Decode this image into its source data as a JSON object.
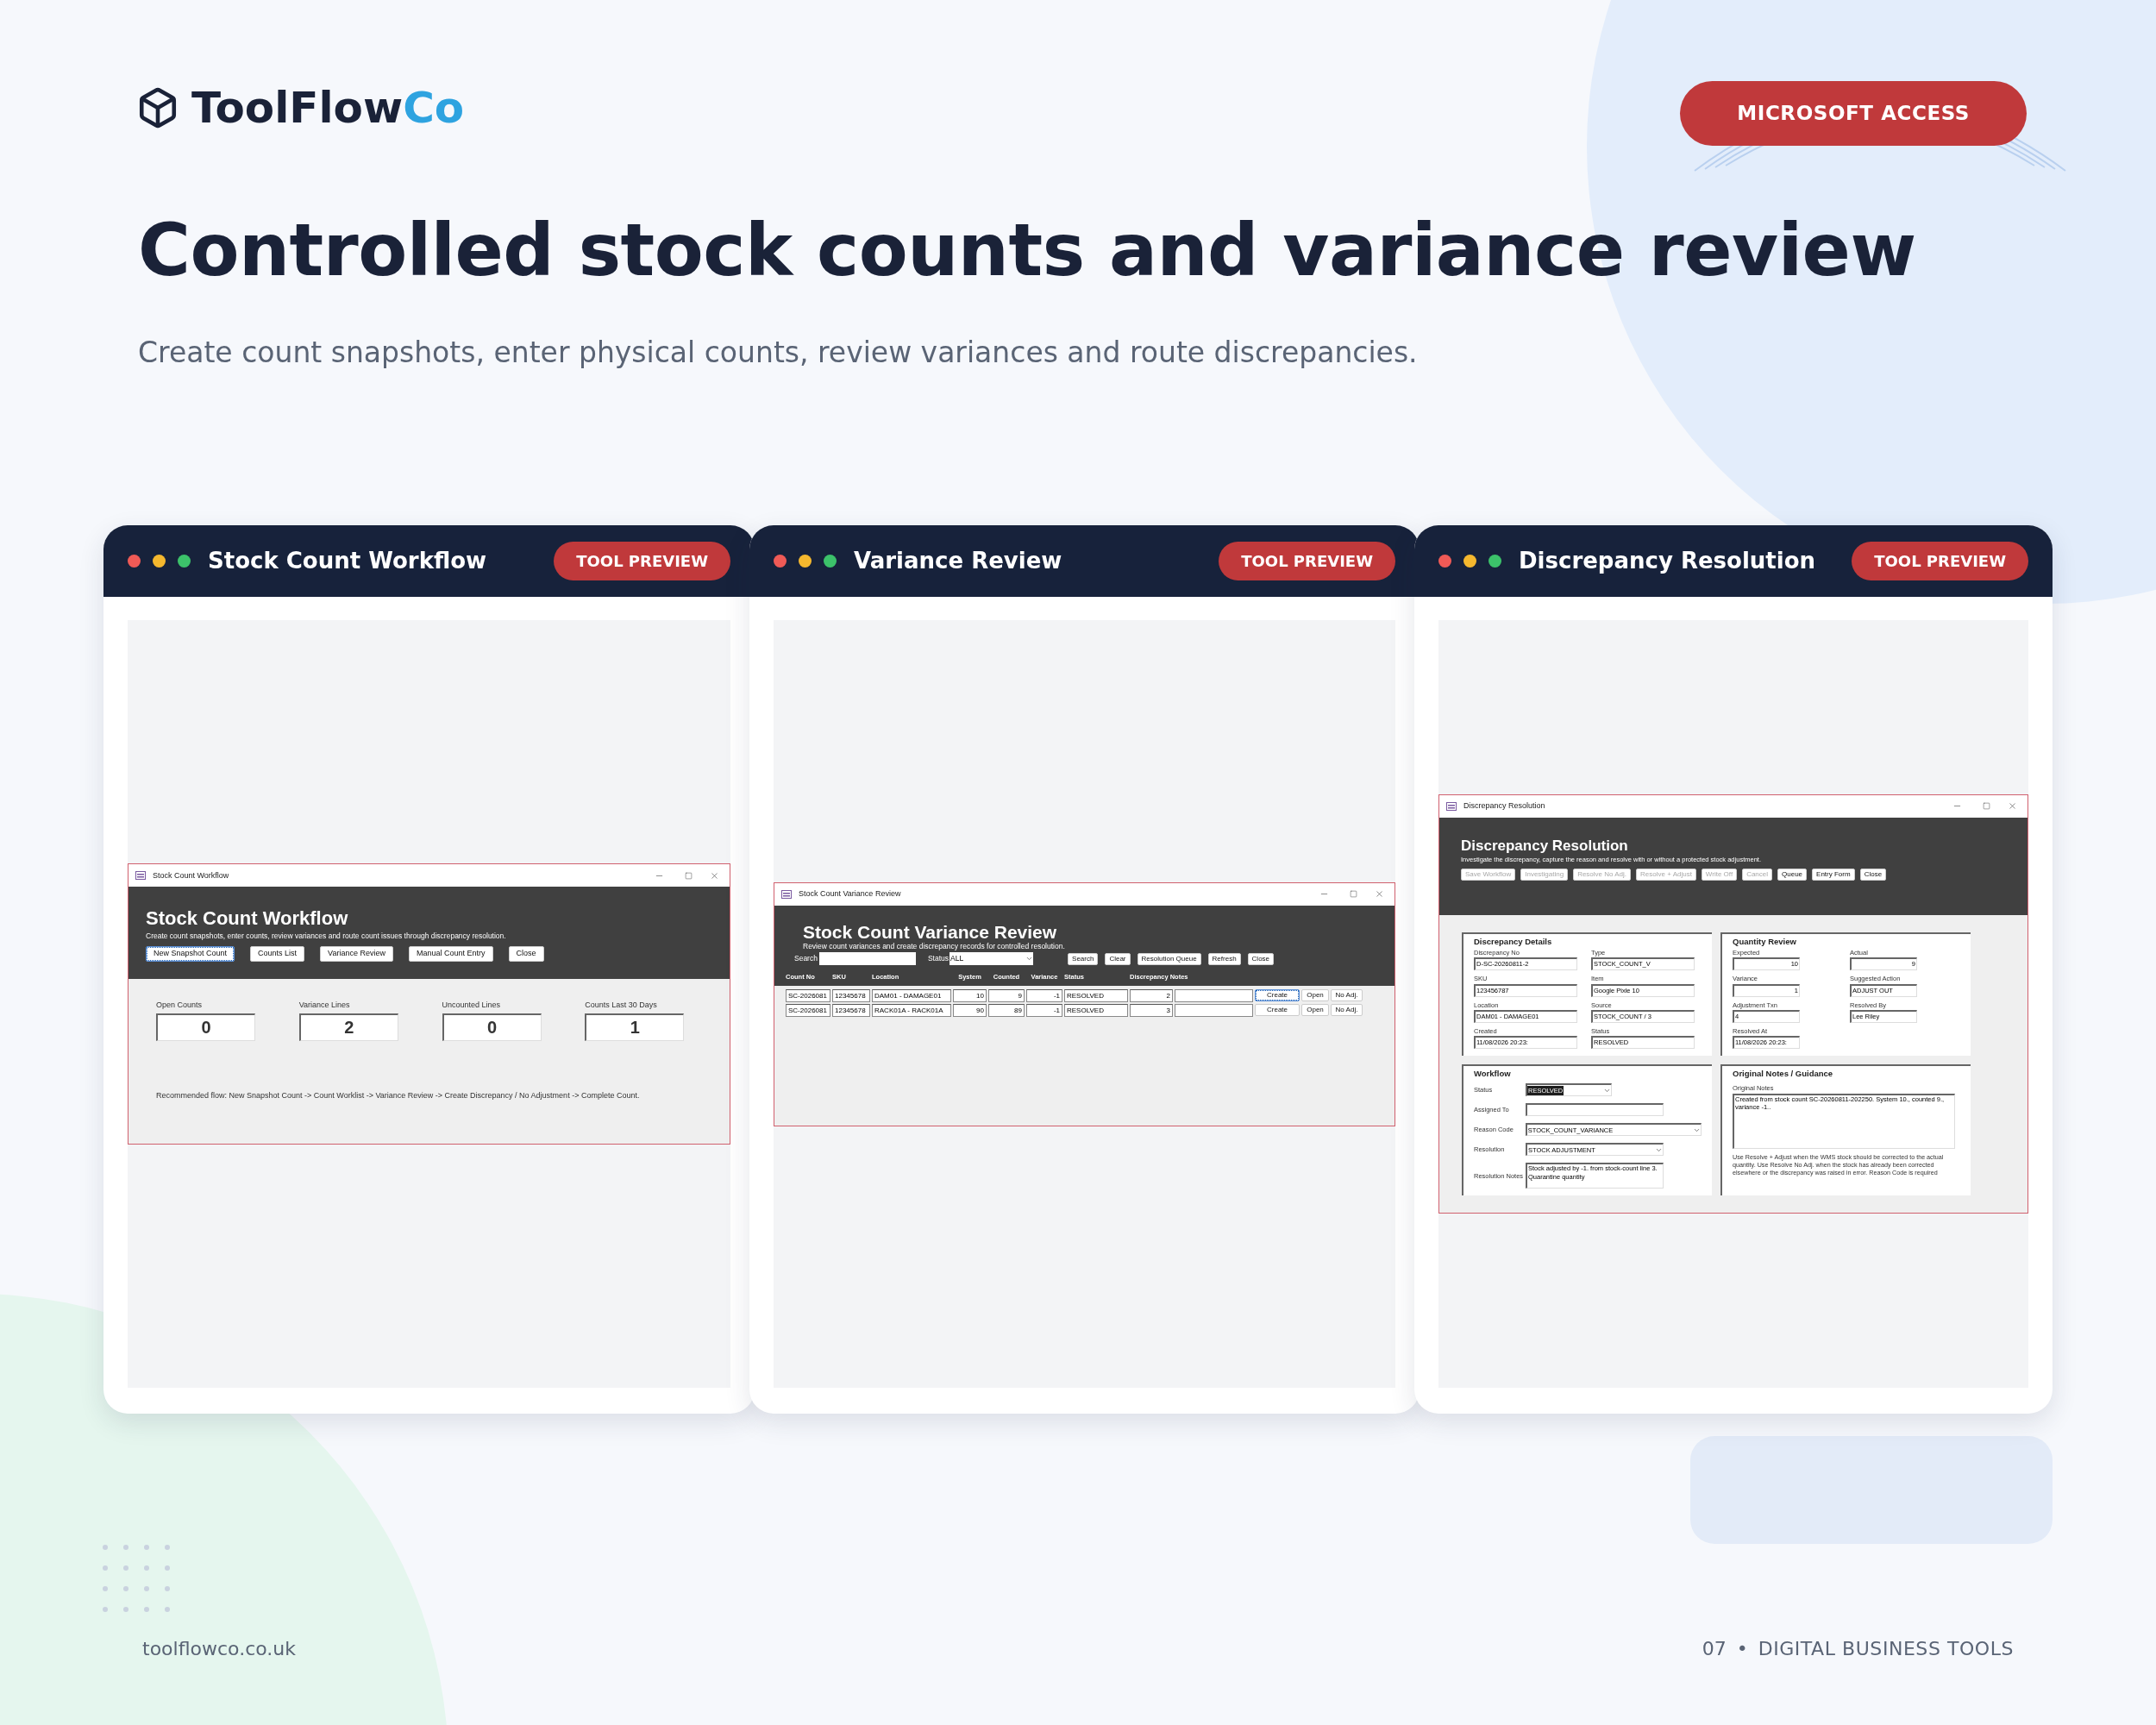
{
  "brand": {
    "name_main": "ToolFlow",
    "name_accent": "Co"
  },
  "badge": "MICROSOFT ACCESS",
  "headline": "Controlled stock counts and variance review",
  "subtitle": "Create count snapshots, enter physical counts, review variances and route discrepancies.",
  "cards": [
    {
      "kind": "workflow",
      "title": "Stock Count Workflow",
      "tag": "TOOL PREVIEW",
      "window": {
        "title": "Stock Count Workflow",
        "heading": "Stock Count Workflow",
        "description": "Create count snapshots, enter counts, review variances and route count issues through discrepancy resolution.",
        "buttons": [
          {
            "label": "New Snapshot Count",
            "focused": true
          },
          {
            "label": "Counts List",
            "focused": false
          },
          {
            "label": "Variance Review",
            "focused": false
          },
          {
            "label": "Manual Count Entry",
            "focused": false
          },
          {
            "label": "Close",
            "focused": false
          }
        ],
        "stats": [
          {
            "label": "Open Counts",
            "value": "0"
          },
          {
            "label": "Variance Lines",
            "value": "2"
          },
          {
            "label": "Uncounted Lines",
            "value": "0"
          },
          {
            "label": "Counts Last 30 Days",
            "value": "1"
          }
        ],
        "note": "Recommended flow: New Snapshot Count -> Count Worklist -> Variance Review -> Create Discrepancy / No Adjustment -> Complete Count."
      }
    },
    {
      "kind": "variance",
      "title": "Variance Review",
      "tag": "TOOL PREVIEW",
      "window": {
        "title": "Stock Count Variance Review",
        "heading": "Stock Count Variance Review",
        "description": "Review count variances and create discrepancy records for controlled resolution.",
        "search_label": "Search",
        "status_label": "Status",
        "status_value": "ALL",
        "buttons": [
          {
            "label": "Search",
            "focused": false
          },
          {
            "label": "Clear",
            "focused": false
          },
          {
            "label": "Resolution Queue",
            "focused": false
          },
          {
            "label": "Refresh",
            "focused": false
          },
          {
            "label": "Close",
            "focused": false
          }
        ],
        "columns": [
          {
            "label": "Count No",
            "kind": "text"
          },
          {
            "label": "SKU",
            "kind": "text"
          },
          {
            "label": "Location",
            "kind": "text"
          },
          {
            "label": "System",
            "kind": "number"
          },
          {
            "label": "Counted",
            "kind": "number"
          },
          {
            "label": "Variance",
            "kind": "number"
          },
          {
            "label": "Status",
            "kind": "text"
          },
          {
            "label": "Discrepancy Notes",
            "kind": "number"
          }
        ],
        "rows": [
          {
            "cells": [
              "SC-2026081",
              "12345678",
              "DAM01 - DAMAGE01",
              "10",
              "9",
              "-1",
              "RESOLVED",
              "2"
            ],
            "actions": [
              {
                "label": "Create",
                "focused": true
              },
              {
                "label": "Open",
                "focused": false
              },
              {
                "label": "No Adj.",
                "focused": false
              }
            ]
          },
          {
            "cells": [
              "SC-2026081",
              "12345678",
              "RACK01A - RACK01A",
              "90",
              "89",
              "-1",
              "RESOLVED",
              "3"
            ],
            "actions": [
              {
                "label": "Create",
                "focused": false
              },
              {
                "label": "Open",
                "focused": false
              },
              {
                "label": "No Adj.",
                "focused": false
              }
            ]
          }
        ]
      }
    },
    {
      "kind": "resolution",
      "title": "Discrepancy Resolution",
      "tag": "TOOL PREVIEW",
      "window": {
        "title": "Discrepancy Resolution",
        "heading": "Discrepancy Resolution",
        "description": "Investigate the discrepancy, capture the reason and resolve with or without a protected stock adjustment.",
        "buttons": [
          {
            "label": "Save Workflow",
            "disabled": true
          },
          {
            "label": "Investigating",
            "disabled": true
          },
          {
            "label": "Resolve No Adj.",
            "disabled": true
          },
          {
            "label": "Resolve + Adjust",
            "disabled": true
          },
          {
            "label": "Write Off",
            "disabled": true
          },
          {
            "label": "Cancel",
            "disabled": true
          },
          {
            "label": "Queue",
            "disabled": false
          },
          {
            "label": "Entry Form",
            "disabled": false
          },
          {
            "label": "Close",
            "disabled": false
          }
        ],
        "details": {
          "title": "Discrepancy Details",
          "fields": [
            {
              "label": "Discrepancy No",
              "value": "D-SC-20260811-2"
            },
            {
              "label": "Type",
              "value": "STOCK_COUNT_V"
            },
            {
              "label": "SKU",
              "value": "123456787"
            },
            {
              "label": "Item",
              "value": "Google Pixle 10"
            },
            {
              "label": "Location",
              "value": "DAM01 - DAMAGE01"
            },
            {
              "label": "Source",
              "value": "STOCK_COUNT / 3"
            },
            {
              "label": "Created",
              "value": "11/08/2026 20:23:"
            },
            {
              "label": "Status",
              "value": "RESOLVED"
            }
          ]
        },
        "quantity": {
          "title": "Quantity Review",
          "fields": [
            {
              "label": "Expected",
              "value": "10",
              "kind": "number"
            },
            {
              "label": "Actual",
              "value": "9",
              "kind": "number"
            },
            {
              "label": "Variance",
              "value": "1",
              "kind": "number"
            },
            {
              "label": "Suggested Action",
              "value": "ADJUST OUT",
              "kind": "text"
            },
            {
              "label": "Adjustment Txn",
              "value": "4",
              "kind": "text"
            },
            {
              "label": "Resolved By",
              "value": "Lee Riley",
              "kind": "text"
            },
            {
              "label": "Resolved At",
              "value": "11/08/2026 20:23:",
              "kind": "text"
            }
          ]
        },
        "workflow": {
          "title": "Workflow",
          "fields": [
            {
              "label": "Status",
              "value": "RESOLVED",
              "kind": "combo",
              "highlighted": true
            },
            {
              "label": "Assigned To",
              "kind": "text"
            },
            {
              "label": "Reason Code",
              "value": "STOCK_COUNT_VARIANCE",
              "kind": "combo"
            },
            {
              "label": "Resolution",
              "value": "STOCK ADJUSTMENT",
              "kind": "combo"
            },
            {
              "label": "Resolution Notes",
              "value": "Stock adjusted by -1. from stock-count line 3. Quarantine quantity",
              "kind": "memo"
            }
          ]
        },
        "notes": {
          "title": "Original Notes / Guidance",
          "label": "Original Notes",
          "value": "Created from stock count SC-20260811-202250. System 10., counted 9., variance -1..",
          "guidance": "Use Resolve + Adjust when the WMS stock should be corrected to the actual quantity. Use Resolve No Adj. when the stock has already been corrected elsewhere or the discrepancy was raised in error. Reason Code is required"
        }
      }
    }
  ],
  "footer": {
    "site": "toolflowco.co.uk",
    "page": "07",
    "separator": "•",
    "section": "DIGITAL BUSINESS TOOLS"
  }
}
